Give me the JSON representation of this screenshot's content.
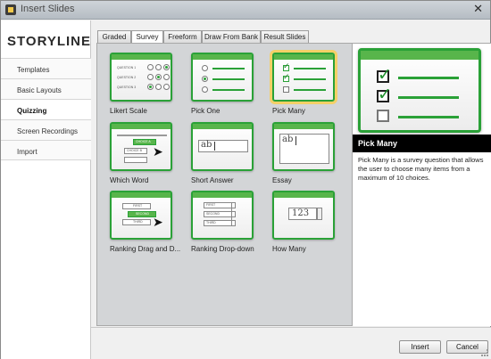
{
  "window": {
    "title": "Insert Slides",
    "close_glyph": "✕"
  },
  "sidebar": {
    "brand": "STORYLINE",
    "items": [
      {
        "label": "Templates"
      },
      {
        "label": "Basic Layouts"
      },
      {
        "label": "Quizzing",
        "active": true
      },
      {
        "label": "Screen Recordings"
      },
      {
        "label": "Import"
      }
    ]
  },
  "tabs": [
    {
      "label": "Graded"
    },
    {
      "label": "Survey",
      "active": true
    },
    {
      "label": "Freeform"
    },
    {
      "label": "Draw From Bank"
    },
    {
      "label": "Result Slides"
    }
  ],
  "tiles": [
    {
      "label": "Likert Scale",
      "icon": "likert-scale-icon",
      "q1": "QUESTION 1",
      "q2": "QUESTION 2",
      "q3": "QUESTION 3"
    },
    {
      "label": "Pick One",
      "icon": "pick-one-icon"
    },
    {
      "label": "Pick Many",
      "icon": "pick-many-icon",
      "selected": true
    },
    {
      "label": "Which Word",
      "icon": "which-word-icon",
      "c1": "CHOICE A",
      "c2": "CHOICE B"
    },
    {
      "label": "Short Answer",
      "icon": "short-answer-icon",
      "field_text": "ab"
    },
    {
      "label": "Essay",
      "icon": "essay-icon",
      "field_text": "ab"
    },
    {
      "label": "Ranking Drag and D...",
      "icon": "ranking-drag-icon",
      "r1": "FIRST",
      "r2": "SECOND",
      "r3": "THIRD"
    },
    {
      "label": "Ranking Drop-down",
      "icon": "ranking-dropdown-icon",
      "r1": "FIRST",
      "r2": "SECOND",
      "r3": "THIRD"
    },
    {
      "label": "How Many",
      "icon": "how-many-icon",
      "value": "123"
    }
  ],
  "preview": {
    "title": "Pick Many",
    "description": "Pick Many is a survey question that allows the user to choose many items from a maximum of 10 choices."
  },
  "buttons": {
    "insert": "Insert",
    "cancel": "Cancel"
  },
  "colors": {
    "accent_green": "#2aa137",
    "selection_yellow": "#f4d067"
  }
}
